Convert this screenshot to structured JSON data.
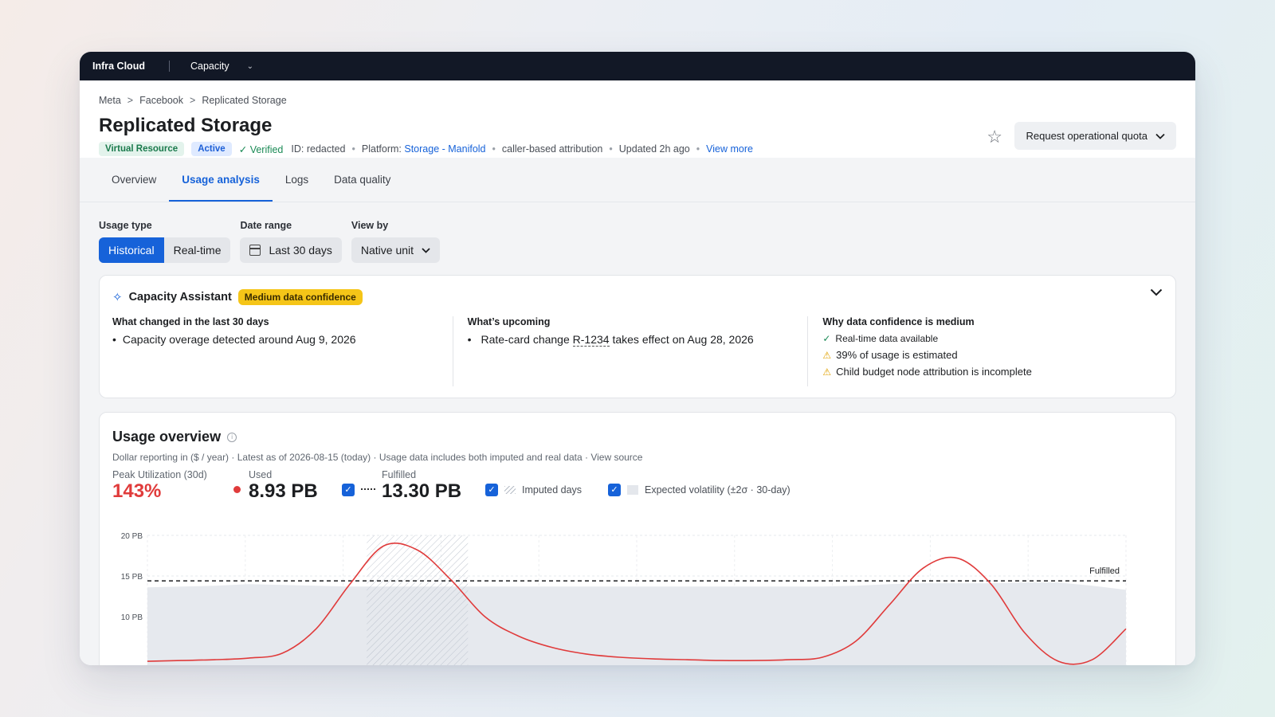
{
  "topbar": {
    "brand": "Infra Cloud",
    "section": "Capacity"
  },
  "breadcrumb": [
    "Meta",
    "Facebook",
    "Replicated Storage"
  ],
  "breadcrumb_sep": ">",
  "page_title": "Replicated Storage",
  "meta": {
    "badge_virtual": "Virtual Resource",
    "badge_active": "Active",
    "verified": "Verified",
    "id": "ID: redacted",
    "platform_label": "Platform:",
    "platform_value": "Storage - Manifold",
    "attribution": "caller-based attribution",
    "updated": "Updated 2h ago",
    "view_more": "View more"
  },
  "request_button": "Request operational quota",
  "tabs": [
    "Overview",
    "Usage analysis",
    "Logs",
    "Data quality"
  ],
  "active_tab": "Usage analysis",
  "controls": {
    "usage_type_label": "Usage type",
    "usage_type_options": [
      "Historical",
      "Real-time"
    ],
    "usage_type_selected": "Historical",
    "date_range_label": "Date range",
    "date_range_value": "Last 30 days",
    "view_by_label": "View by",
    "view_by_value": "Native unit"
  },
  "assistant": {
    "title": "Capacity Assistant",
    "confidence_badge": "Medium data confidence",
    "changed_title": "What changed in the last 30 days",
    "changed_items": [
      "Capacity overage detected around Aug 9, 2026"
    ],
    "upcoming_title": "What’s upcoming",
    "upcoming_prefix": "Rate-card change",
    "upcoming_link": "R-1234",
    "upcoming_suffix": "takes effect on Aug 28, 2026",
    "why_title": "Why data confidence is medium",
    "why_items": [
      {
        "status": "ok",
        "text": "Real-time data available"
      },
      {
        "status": "warn",
        "text": "39% of usage is estimated"
      },
      {
        "status": "warn",
        "text": "Child budget node attribution is incomplete"
      }
    ]
  },
  "overview": {
    "title": "Usage overview",
    "subtitle": "Dollar reporting in ($ / year) · Latest as of 2026-08-15 (today) · Usage data includes both imputed and real data · View source",
    "peak_label": "Peak Utilization (30d)",
    "peak_value": "143%",
    "used_label": "Used",
    "used_value": "8.93 PB",
    "fulfilled_label": "Fulfilled",
    "fulfilled_value": "13.30 PB",
    "legend_imputed": "Imputed days",
    "legend_volatility": "Expected volatility (±2σ · 30-day)"
  },
  "colors": {
    "accent": "#1662d9",
    "used": "#e03b3b",
    "warn_badge": "#f5c518"
  },
  "chart_data": {
    "type": "line",
    "y_ticks": [
      "20 PB",
      "15 PB",
      "10 PB"
    ],
    "ylim": [
      0,
      20
    ],
    "fulfilled_line_label": "Fulfilled",
    "fulfilled_value": 14.4,
    "x": [
      0,
      1,
      2,
      3,
      4,
      5,
      6,
      7,
      8,
      9,
      10,
      11,
      12,
      13,
      14,
      15,
      16,
      17,
      18,
      19,
      20,
      21,
      22,
      23,
      24,
      25,
      26,
      27,
      28,
      29
    ],
    "series": [
      {
        "values": [
          4.5,
          4.6,
          4.7,
          4.9,
          5.5,
          8.5,
          14.0,
          18.7,
          18.2,
          14.5,
          10.0,
          7.6,
          6.2,
          5.4,
          5.0,
          4.8,
          4.7,
          4.6,
          4.6,
          4.7,
          5.0,
          7.0,
          11.5,
          16.0,
          17.2,
          14.0,
          8.0,
          4.5,
          4.7,
          8.5
        ]
      }
    ],
    "volatility_band_upper": [
      13.6,
      13.7,
      13.8,
      14.0,
      13.9,
      13.8,
      13.7,
      13.7,
      13.7,
      13.7,
      13.7,
      13.7,
      13.7,
      13.7,
      13.7,
      13.7,
      13.7,
      13.7,
      13.7,
      13.7,
      13.7,
      13.8,
      14.0,
      14.1,
      14.1,
      14.1,
      14.2,
      14.2,
      13.8,
      13.3
    ],
    "imputed_range": [
      6.5,
      9.5
    ],
    "grid": true
  }
}
